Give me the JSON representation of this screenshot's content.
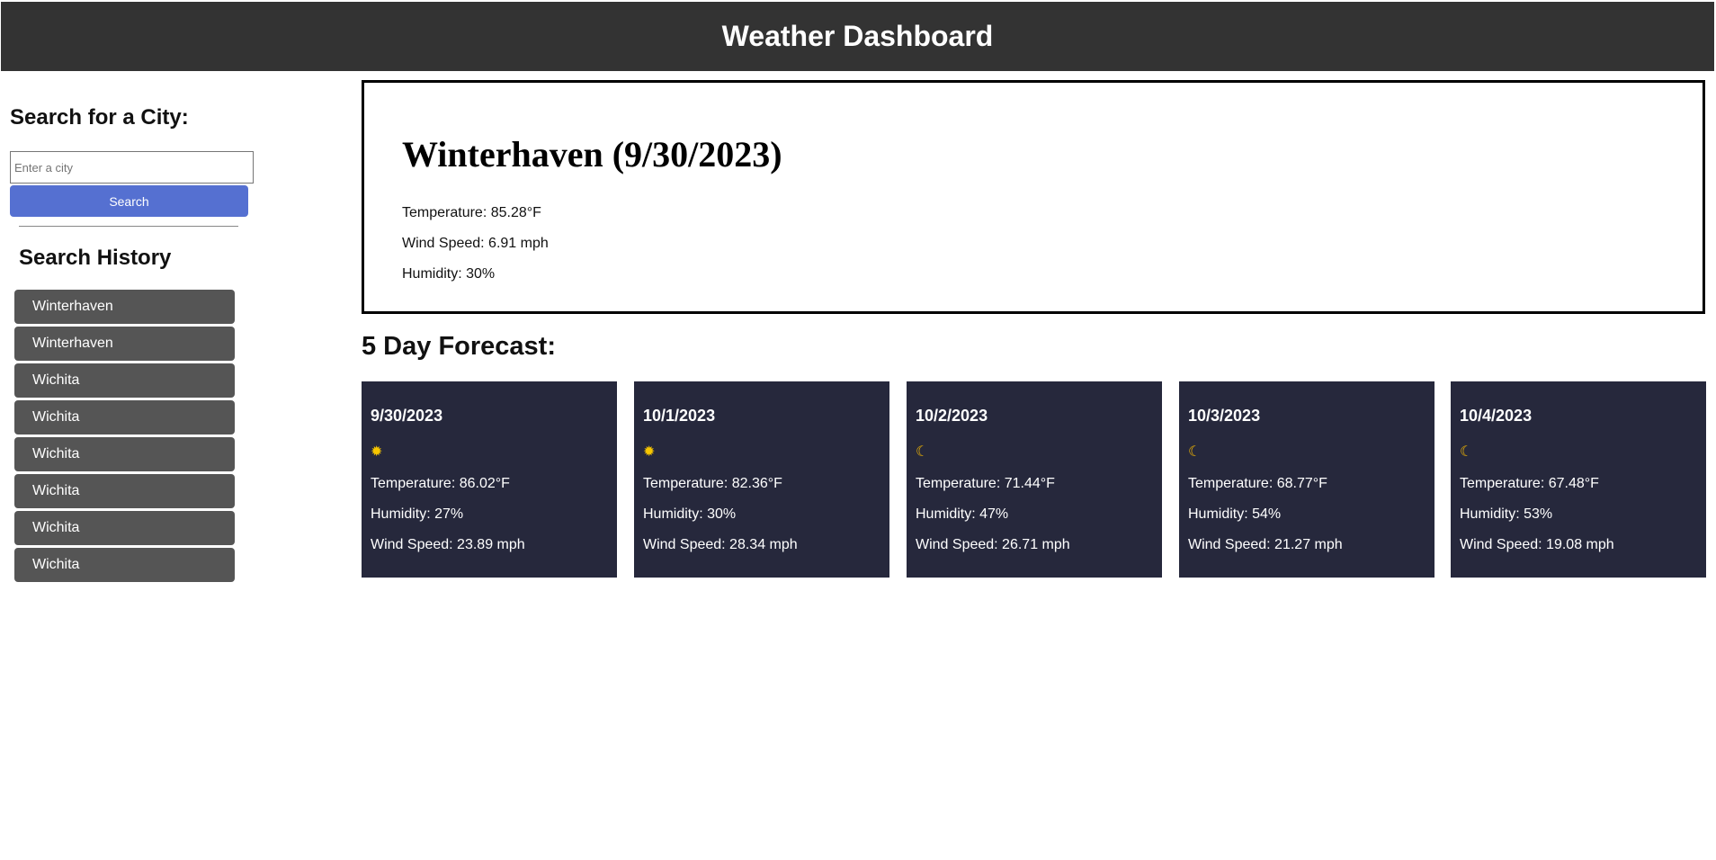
{
  "header": {
    "title": "Weather Dashboard"
  },
  "sidebar": {
    "search_heading": "Search for a City:",
    "search_placeholder": "Enter a city",
    "search_value": "",
    "search_button": "Search",
    "history_heading": "Search History",
    "history": [
      {
        "label": "Winterhaven"
      },
      {
        "label": "Winterhaven"
      },
      {
        "label": "Wichita"
      },
      {
        "label": "Wichita"
      },
      {
        "label": "Wichita"
      },
      {
        "label": "Wichita"
      },
      {
        "label": "Wichita"
      },
      {
        "label": "Wichita"
      }
    ]
  },
  "current": {
    "title": "Winterhaven (9/30/2023)",
    "temperature": "Temperature: 85.28°F",
    "wind": "Wind Speed: 6.91 mph",
    "humidity": "Humidity: 30%"
  },
  "forecast": {
    "heading": "5 Day Forecast:",
    "days": [
      {
        "date": "9/30/2023",
        "icon": "sun-icon",
        "glyph": "✹",
        "temperature": "Temperature: 86.02°F",
        "humidity": "Humidity: 27%",
        "wind": "Wind Speed: 23.89 mph"
      },
      {
        "date": "10/1/2023",
        "icon": "sun-icon",
        "glyph": "✹",
        "temperature": "Temperature: 82.36°F",
        "humidity": "Humidity: 30%",
        "wind": "Wind Speed: 28.34 mph"
      },
      {
        "date": "10/2/2023",
        "icon": "moon-icon",
        "glyph": "☾",
        "temperature": "Temperature: 71.44°F",
        "humidity": "Humidity: 47%",
        "wind": "Wind Speed: 26.71 mph"
      },
      {
        "date": "10/3/2023",
        "icon": "moon-icon",
        "glyph": "☾",
        "temperature": "Temperature: 68.77°F",
        "humidity": "Humidity: 54%",
        "wind": "Wind Speed: 21.27 mph"
      },
      {
        "date": "10/4/2023",
        "icon": "moon-icon",
        "glyph": "☾",
        "temperature": "Temperature: 67.48°F",
        "humidity": "Humidity: 53%",
        "wind": "Wind Speed: 19.08 mph"
      }
    ]
  },
  "colors": {
    "header_bg": "#333333",
    "search_button_bg": "#5570d1",
    "history_button_bg": "#555555",
    "forecast_card_bg": "#26283c",
    "sun_icon": "#f7c600",
    "moon_icon": "#f5b800"
  }
}
